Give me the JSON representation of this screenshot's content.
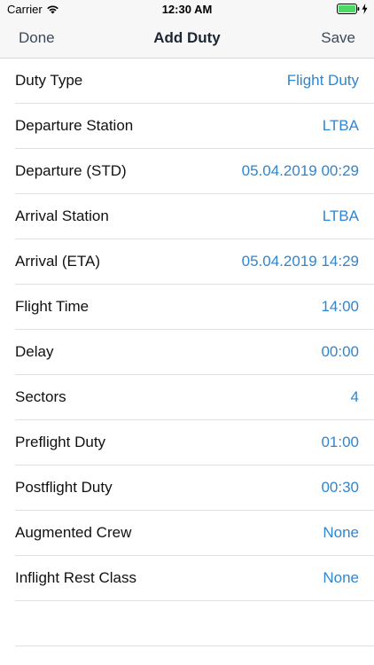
{
  "status_bar": {
    "carrier": "Carrier",
    "time": "12:30 AM",
    "battery_color": "#4cd964",
    "icons": [
      "wifi-icon",
      "battery-icon",
      "charging-bolt-icon"
    ]
  },
  "nav": {
    "left_label": "Done",
    "title": "Add Duty",
    "right_label": "Save",
    "tint_color": "#3a4a5c"
  },
  "rows": [
    {
      "label": "Duty Type",
      "value": "Flight Duty"
    },
    {
      "label": "Departure Station",
      "value": "LTBA"
    },
    {
      "label": "Departure (STD)",
      "value": "05.04.2019 00:29"
    },
    {
      "label": "Arrival Station",
      "value": "LTBA"
    },
    {
      "label": "Arrival (ETA)",
      "value": "05.04.2019 14:29"
    },
    {
      "label": "Flight Time",
      "value": "14:00"
    },
    {
      "label": "Delay",
      "value": "00:00"
    },
    {
      "label": "Sectors",
      "value": "4"
    },
    {
      "label": "Preflight Duty",
      "value": "01:00"
    },
    {
      "label": "Postflight Duty",
      "value": "00:30"
    },
    {
      "label": "Augmented Crew",
      "value": "None"
    },
    {
      "label": "Inflight Rest Class",
      "value": "None"
    }
  ],
  "value_color": "#2f86d0"
}
